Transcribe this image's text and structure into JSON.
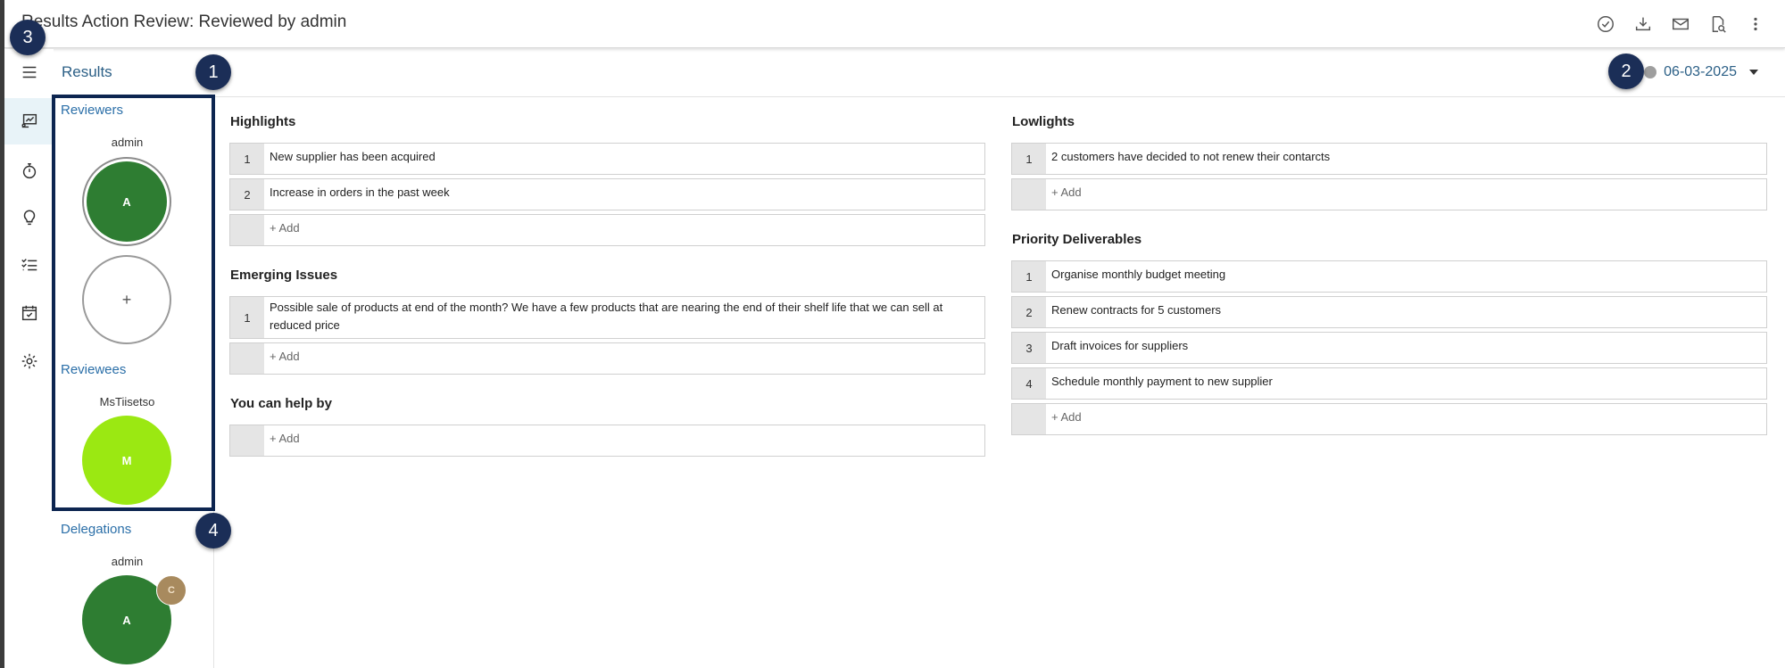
{
  "header": {
    "title": "Results Action Review: Reviewed by admin"
  },
  "toolbar_icons": [
    "check-circle-icon",
    "download-icon",
    "mail-icon",
    "document-search-icon",
    "more-vertical-icon"
  ],
  "rail_icons": [
    "menu-icon",
    "results-icon",
    "stopwatch-icon",
    "lightbulb-icon",
    "checklist-icon",
    "calendar-check-icon",
    "gear-icon"
  ],
  "page": {
    "title": "Results",
    "date": "06-03-2025"
  },
  "people": {
    "reviewers_label": "Reviewers",
    "reviewer": {
      "name": "admin",
      "initial": "A"
    },
    "add_symbol": "+",
    "reviewees_label": "Reviewees",
    "reviewee": {
      "name": "MsTiisetso",
      "initial": "M"
    },
    "delegations_label": "Delegations",
    "delegation": {
      "name": "admin",
      "initial": "A",
      "badge": "C"
    }
  },
  "markers": [
    "1",
    "2",
    "3",
    "4"
  ],
  "sections": {
    "highlights": {
      "title": "Highlights",
      "items": [
        {
          "num": "1",
          "text": "New supplier has been acquired"
        },
        {
          "num": "2",
          "text": "Increase in orders in the past week"
        }
      ],
      "add": "+ Add"
    },
    "emerging": {
      "title": "Emerging Issues",
      "items": [
        {
          "num": "1",
          "text": "Possible sale of products at end of the month? We have a few products that are nearing the end of their shelf life that we can sell at reduced price"
        }
      ],
      "add": "+ Add"
    },
    "help": {
      "title": "You can help by",
      "add": "+ Add"
    },
    "lowlights": {
      "title": "Lowlights",
      "items": [
        {
          "num": "1",
          "text": "2 customers have decided to not renew their contarcts"
        }
      ],
      "add": "+ Add"
    },
    "priority": {
      "title": "Priority Deliverables",
      "items": [
        {
          "num": "1",
          "text": "Organise monthly budget meeting"
        },
        {
          "num": "2",
          "text": "Renew contracts for 5 customers"
        },
        {
          "num": "3",
          "text": "Draft invoices for suppliers"
        },
        {
          "num": "4",
          "text": "Schedule monthly payment to new supplier"
        }
      ],
      "add": "+ Add"
    }
  },
  "colors": {
    "reviewer_avatar": "#2e7d32",
    "reviewee_avatar": "#9be812",
    "badge": "#a88a5e",
    "marker": "#1b2e57",
    "highlight_border": "#0d2550"
  }
}
